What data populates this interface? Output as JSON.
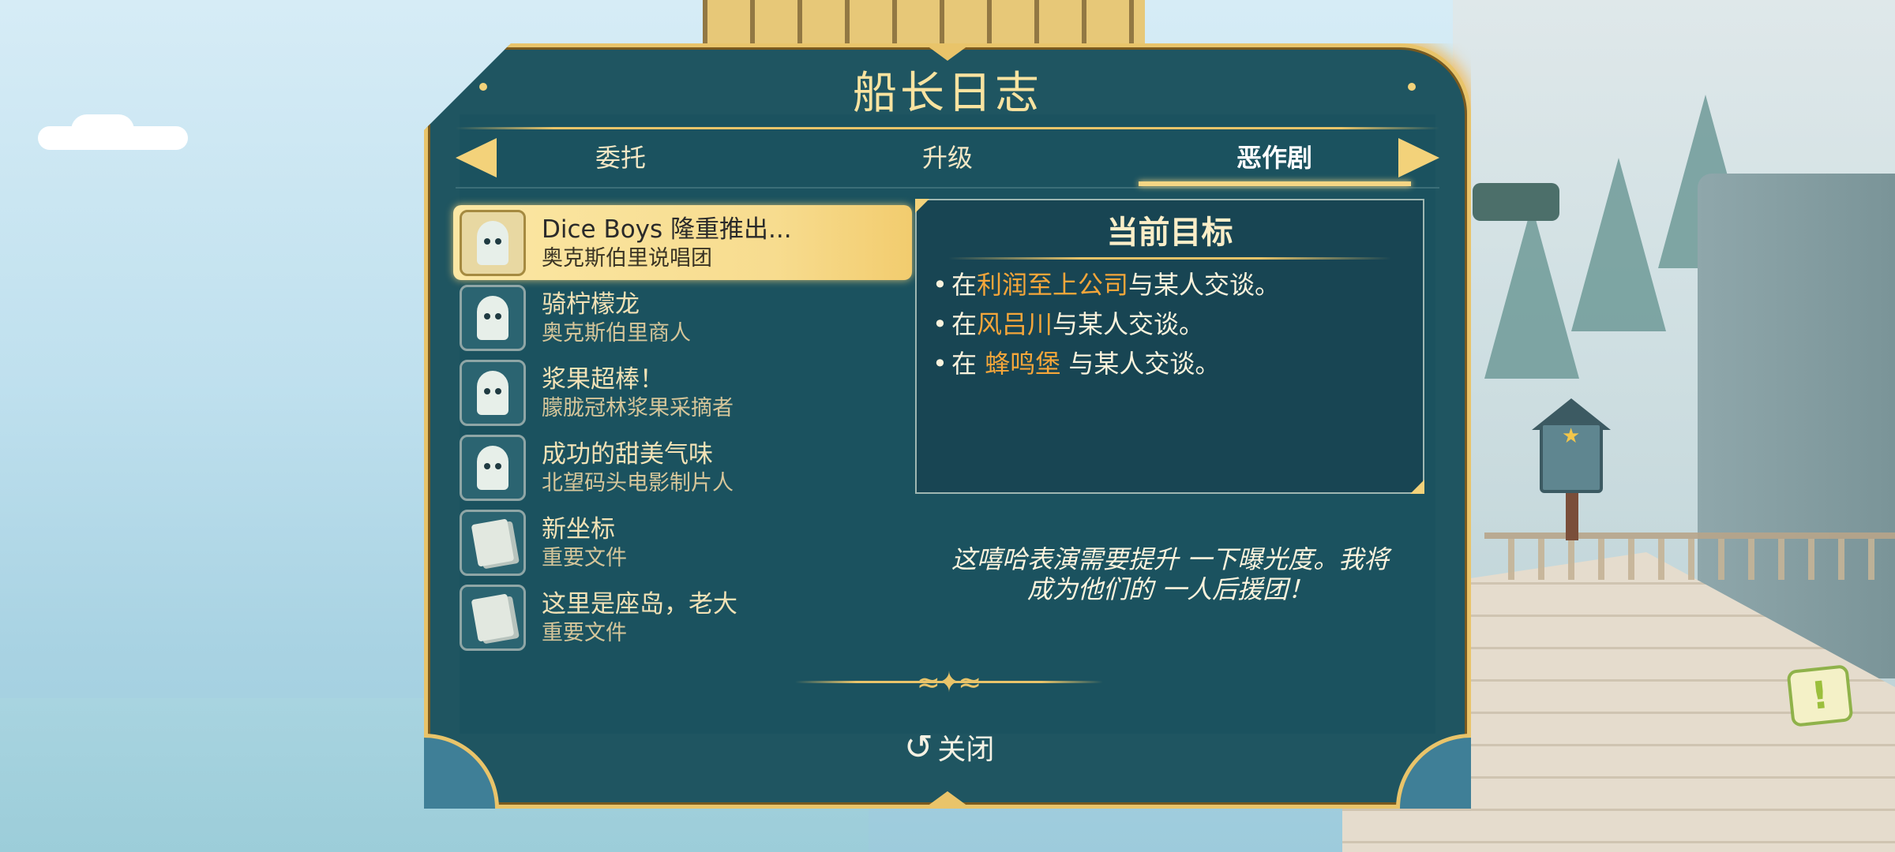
{
  "dialog": {
    "title": "船长日志",
    "tabs": [
      {
        "label": "委托",
        "active": false
      },
      {
        "label": "升级",
        "active": false
      },
      {
        "label": "恶作剧",
        "active": true
      }
    ],
    "quests": [
      {
        "title": "Dice Boys 隆重推出...",
        "giver": "奥克斯伯里说唱团",
        "icon": "ghost-icon",
        "selected": true
      },
      {
        "title": "骑柠檬龙",
        "giver": "奥克斯伯里商人",
        "icon": "ghost-icon",
        "selected": false
      },
      {
        "title": "浆果超棒！",
        "giver": "朦胧冠林浆果采摘者",
        "icon": "ghost-icon",
        "selected": false
      },
      {
        "title": "成功的甜美气味",
        "giver": "北望码头电影制片人",
        "icon": "ghost-icon",
        "selected": false
      },
      {
        "title": "新坐标",
        "giver": "重要文件",
        "icon": "document-icon",
        "selected": false
      },
      {
        "title": "这里是座岛，老大",
        "giver": "重要文件",
        "icon": "document-icon",
        "selected": false
      }
    ],
    "objectives": {
      "title": "当前目标",
      "items": [
        {
          "prefix": "在",
          "location": "利润至上公司",
          "suffix": "与某人交谈。"
        },
        {
          "prefix": "在",
          "location": "风吕川",
          "suffix": "与某人交谈。"
        },
        {
          "prefix": "在 ",
          "location": "蜂鸣堡",
          "suffix": " 与某人交谈。"
        }
      ]
    },
    "flavor_text": "这嘻哈表演需要提升 一下曝光度。我将成为他们的 一人后援团！",
    "close_label": "关闭"
  },
  "colors": {
    "panel": "#1f5561",
    "gold": "#e9c46a",
    "location_highlight": "#f5a63a",
    "selected_row": "#f7dc8f"
  }
}
